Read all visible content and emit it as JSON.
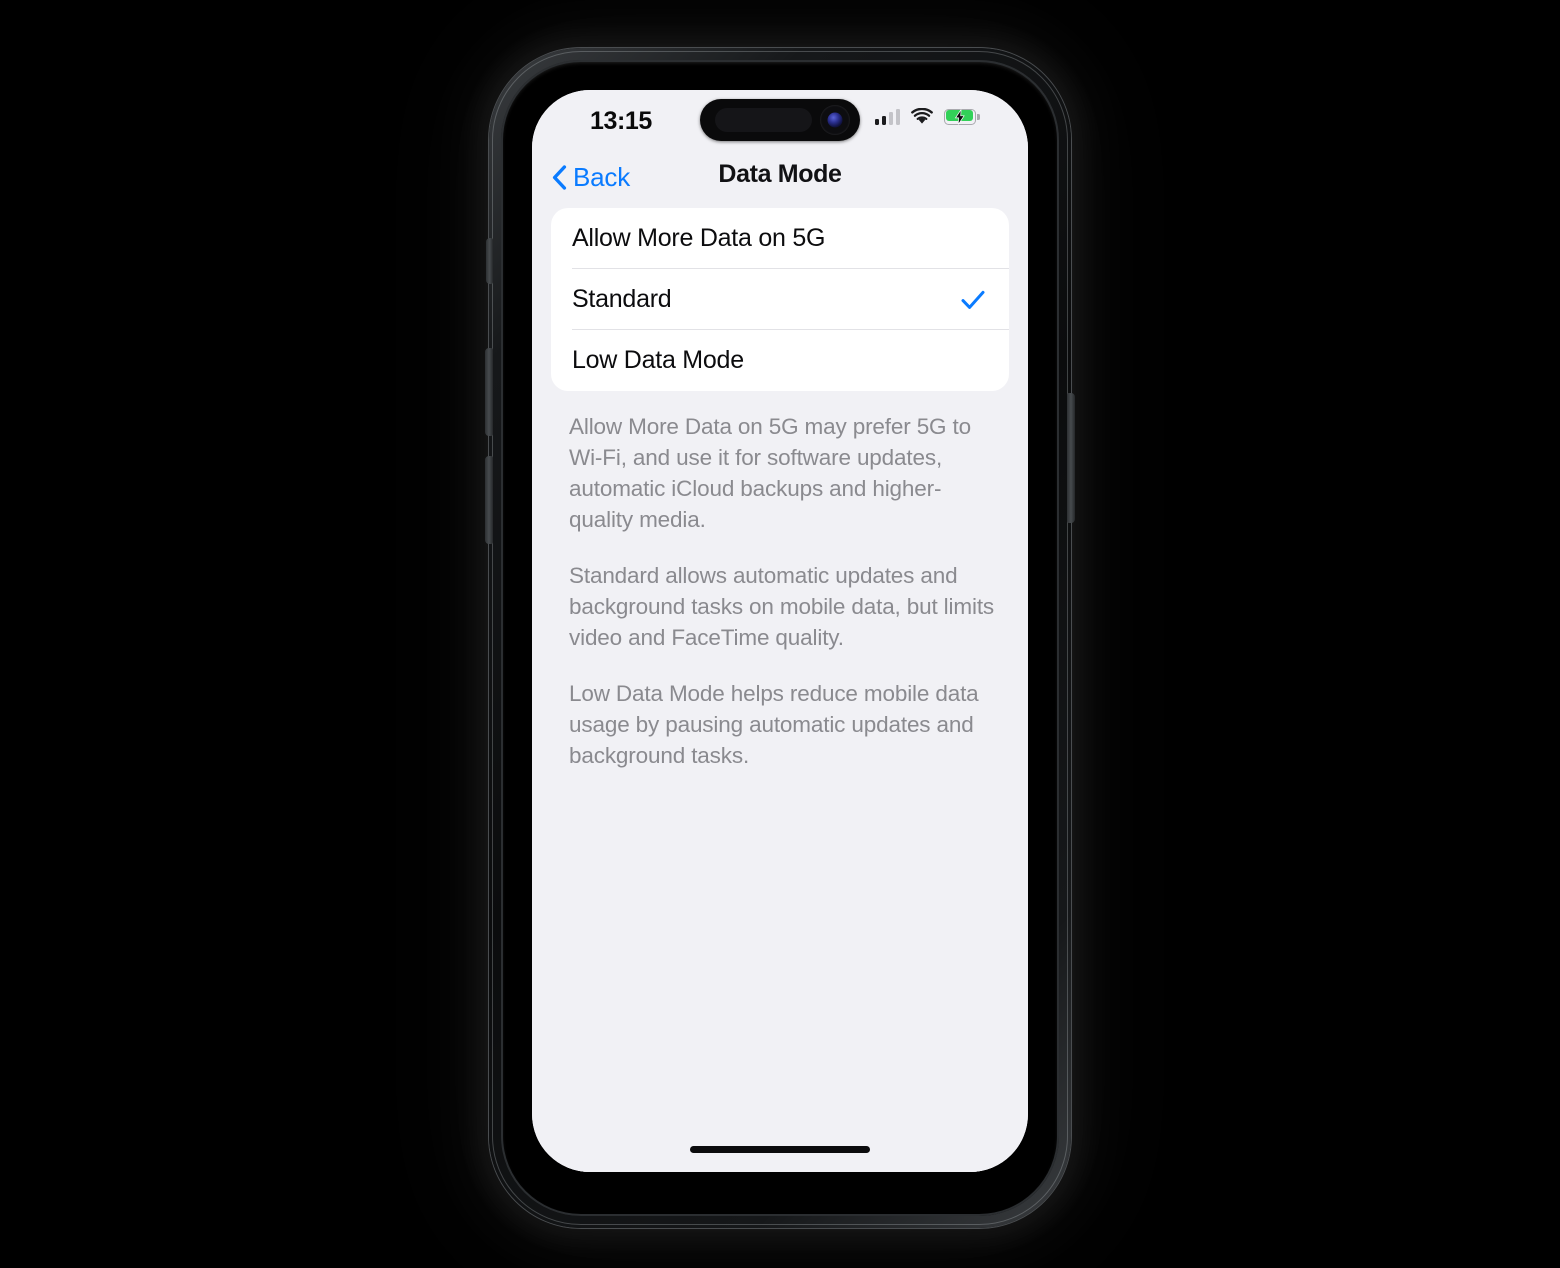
{
  "device": {
    "name": "iphone-mockup",
    "buttons": [
      "action-button",
      "volume-up",
      "volume-down",
      "power-button"
    ]
  },
  "status_bar": {
    "time": "13:15",
    "signal_icon": "cellular-signal-icon",
    "signal_bars_filled": 2,
    "signal_bars_total": 4,
    "wifi_icon": "wifi-icon",
    "battery_icon": "battery-charging-icon",
    "battery_charging": true,
    "battery_color": "#32D158"
  },
  "nav_bar": {
    "back_label": "Back",
    "back_icon": "chevron-left-icon",
    "title": "Data Mode",
    "accent_color": "#0A7BFF"
  },
  "options": [
    {
      "label": "Allow More Data on 5G",
      "selected": false
    },
    {
      "label": "Standard",
      "selected": true
    },
    {
      "label": "Low Data Mode",
      "selected": false
    }
  ],
  "check_icon_name": "checkmark-icon",
  "footer_paragraphs": [
    "Allow More Data on 5G may prefer 5G to Wi-Fi, and use it for software updates, automatic iCloud backups and higher-quality media.",
    "Standard allows automatic updates and background tasks on mobile data, but limits video and FaceTime quality.",
    "Low Data Mode helps reduce mobile data usage by pausing automatic updates and background tasks."
  ],
  "colors": {
    "page_background": "#F1F1F5",
    "card_background": "#FFFFFF",
    "accent": "#0A7BFF",
    "footer_text": "#8A8A8F",
    "divider": "#E2E2E6"
  },
  "home_indicator": "home-indicator"
}
